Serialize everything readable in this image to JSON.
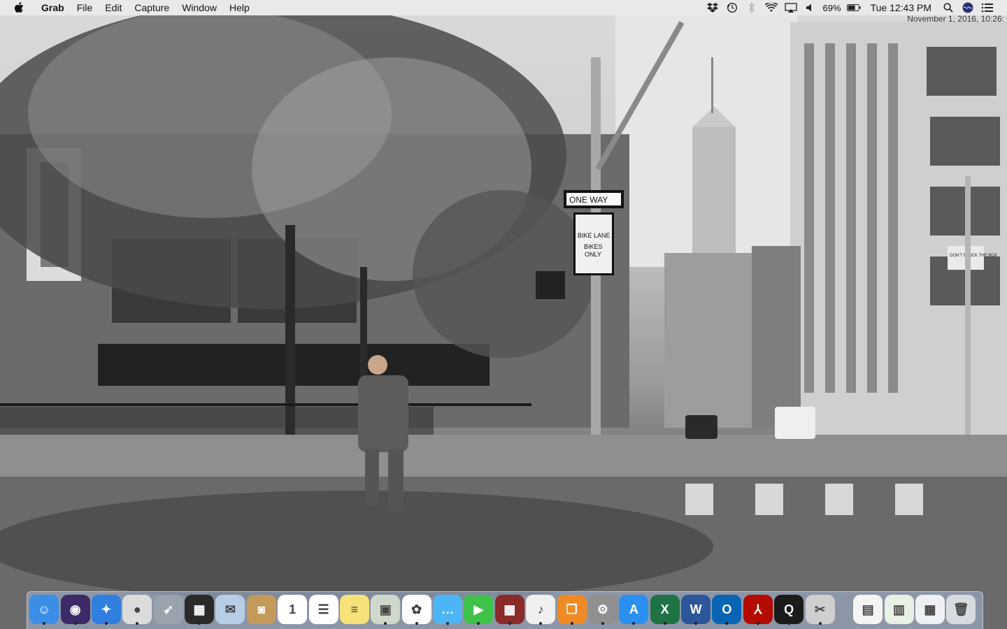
{
  "menubar": {
    "app_name": "Grab",
    "menus": [
      "File",
      "Edit",
      "Capture",
      "Window",
      "Help"
    ],
    "battery_percent": "69%",
    "clock": "Tue 12:43 PM",
    "status_icons": [
      "dropbox-icon",
      "time-machine-icon",
      "bluetooth-icon",
      "wifi-icon",
      "airplay-icon",
      "volume-icon",
      "battery-icon"
    ],
    "right_icons": [
      "spotlight-icon",
      "siri-icon",
      "notification-center-icon"
    ]
  },
  "overlay": {
    "date_stamp": "November 1, 2016, 10:26:"
  },
  "wallpaper": {
    "signs": {
      "one_way": "ONE    WAY",
      "bike_lane_1": "BIKE LANE",
      "bike_lane_2": "BIKES",
      "bike_lane_3": "ONLY",
      "dont_block": "DON'T BLOCK THE BOX"
    }
  },
  "dock": {
    "apps": [
      {
        "name": "finder",
        "color": "#3a8ee6",
        "glyph": "☺"
      },
      {
        "name": "siri",
        "color": "#3b2a66",
        "glyph": "◉"
      },
      {
        "name": "safari",
        "color": "#2f7fe0",
        "glyph": "✦"
      },
      {
        "name": "chrome",
        "color": "#dcdcdc",
        "glyph": "●"
      },
      {
        "name": "launchpad",
        "color": "#9aa3ad",
        "glyph": "➶"
      },
      {
        "name": "mission-control",
        "color": "#2a2a2a",
        "glyph": "▦"
      },
      {
        "name": "mail-stamp",
        "color": "#b7cde6",
        "glyph": "✉"
      },
      {
        "name": "contacts",
        "color": "#c49a5a",
        "glyph": "◙"
      },
      {
        "name": "calendar",
        "color": "#ffffff",
        "glyph": "1"
      },
      {
        "name": "reminders",
        "color": "#ffffff",
        "glyph": "☰"
      },
      {
        "name": "notes",
        "color": "#f7e27a",
        "glyph": "≡"
      },
      {
        "name": "preview",
        "color": "#d0d8cc",
        "glyph": "▣"
      },
      {
        "name": "photos",
        "color": "#ffffff",
        "glyph": "✿"
      },
      {
        "name": "messages",
        "color": "#4db5f5",
        "glyph": "…"
      },
      {
        "name": "facetime",
        "color": "#3ec24a",
        "glyph": "▶"
      },
      {
        "name": "photo-booth",
        "color": "#8a2a2a",
        "glyph": "▩"
      },
      {
        "name": "itunes",
        "color": "#f0f0f0",
        "glyph": "♪"
      },
      {
        "name": "ibooks",
        "color": "#f08a24",
        "glyph": "❐"
      },
      {
        "name": "system-preferences",
        "color": "#8f8f8f",
        "glyph": "⚙"
      },
      {
        "name": "app-store",
        "color": "#2a8ff0",
        "glyph": "A"
      },
      {
        "name": "excel",
        "color": "#1f7244",
        "glyph": "X"
      },
      {
        "name": "word",
        "color": "#2b579a",
        "glyph": "W"
      },
      {
        "name": "outlook",
        "color": "#0a64b4",
        "glyph": "O"
      },
      {
        "name": "acrobat",
        "color": "#b30b00",
        "glyph": "⅄"
      },
      {
        "name": "quicktime",
        "color": "#1b1b1b",
        "glyph": "Q"
      },
      {
        "name": "grab",
        "color": "#cfcfcf",
        "glyph": "✂"
      }
    ],
    "docs": [
      {
        "name": "doc-stack-1",
        "color": "#f4f4f4",
        "glyph": "▤"
      },
      {
        "name": "doc-stack-2",
        "color": "#e9f0e4",
        "glyph": "▥"
      },
      {
        "name": "doc-stack-3",
        "color": "#eef0f4",
        "glyph": "▦"
      },
      {
        "name": "trash",
        "color": "#d7dbe0",
        "glyph": "🗑"
      }
    ]
  }
}
